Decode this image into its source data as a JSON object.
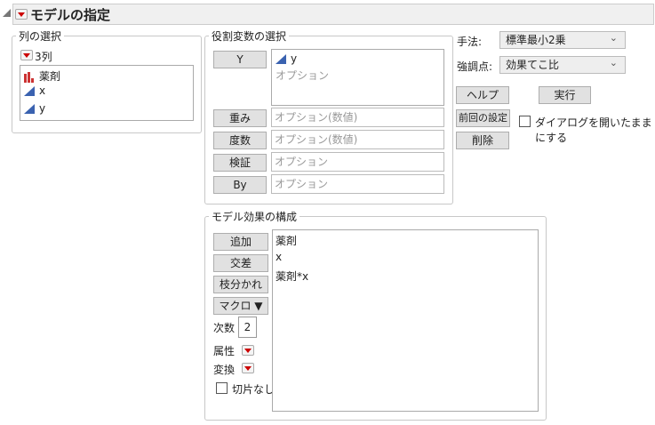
{
  "title": "モデルの指定",
  "columns": {
    "legend": "列の選択",
    "count": "3列",
    "items": [
      {
        "name": "薬剤",
        "type": "nominal"
      },
      {
        "name": "x",
        "type": "continuous"
      },
      {
        "name": "y",
        "type": "continuous"
      }
    ]
  },
  "roles": {
    "legend": "役割変数の選択",
    "y": {
      "label": "Y",
      "value": "y",
      "placeholder": "オプション"
    },
    "weight": {
      "label": "重み",
      "placeholder": "オプション(数値)"
    },
    "freq": {
      "label": "度数",
      "placeholder": "オプション(数値)"
    },
    "validation": {
      "label": "検証",
      "placeholder": "オプション"
    },
    "by": {
      "label": "By",
      "placeholder": "オプション"
    }
  },
  "settings": {
    "method_label": "手法:",
    "method_value": "標準最小2乗",
    "emphasis_label": "強調点:",
    "emphasis_value": "効果てこ比"
  },
  "actions": {
    "help": "ヘルプ",
    "run": "実行",
    "recall": "前回の設定",
    "remove": "削除",
    "keep_open": "ダイアログを開いたままにする",
    "keep_open_checked": false
  },
  "effects": {
    "legend": "モデル効果の構成",
    "add": "追加",
    "cross": "交差",
    "nest": "枝分かれ",
    "macros": "マクロ ▼",
    "degree_label": "次数",
    "degree": "2",
    "attributes": "属性",
    "transform": "変換",
    "no_intercept": "切片なし",
    "no_intercept_checked": false,
    "items": [
      "薬剤",
      "x",
      "薬剤*x"
    ]
  },
  "colors": {
    "continuous": "#3a62b0",
    "nominal": "#cc3333",
    "red_menu": "#cc0000"
  }
}
